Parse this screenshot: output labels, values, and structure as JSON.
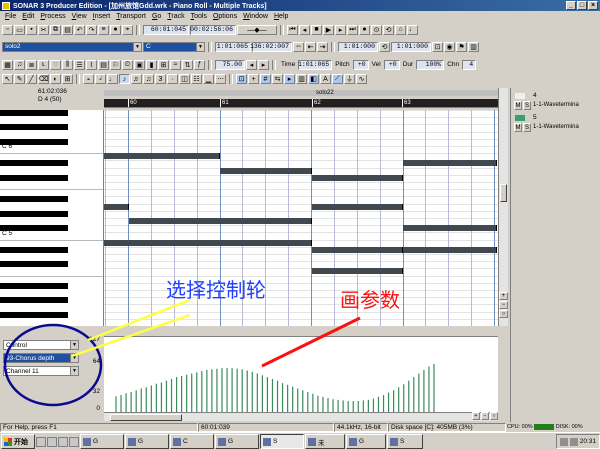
{
  "window": {
    "title": "SONAR 3 Producer Edition - [加州旅馆Gdd.wrk - Piano Roll - Multiple Tracks]",
    "buttons": [
      "_",
      "□",
      "×"
    ]
  },
  "menu": [
    "File",
    "Edit",
    "Process",
    "View",
    "Insert",
    "Transport",
    "Go",
    "Track",
    "Tools",
    "Options",
    "Window",
    "Help"
  ],
  "transport": {
    "time_mbt": "60:01:045",
    "time_smpte": "00:02:56:06"
  },
  "toolbar2": {
    "track_combo": "solo2",
    "key_combo": "C",
    "now_time": "1:01:065",
    "end_time": "136:02:007",
    "loop_start": "1:01:000",
    "loop_end": "1:01:000"
  },
  "toolbar3": {
    "tempo": "75.00",
    "time_label": "Time",
    "time_value": "1:01:065",
    "pitch_label": "Pitch",
    "pitch_value": "+0",
    "vel_label": "Vel",
    "vel_value": "+0",
    "dur_label": "Dur",
    "dur_value": "100%",
    "chn_label": "Chn",
    "chn_value": "4"
  },
  "pianoroll": {
    "position": "61:02:036",
    "note": "D 4 (50)",
    "octave_labels": [
      "C 6",
      "C 5"
    ],
    "ruler_measures": [
      "60",
      "61",
      "62",
      "63"
    ],
    "marker": "solo22",
    "notes": [
      {
        "start": 0.0,
        "end": 1.27,
        "row": 6
      },
      {
        "start": 1.27,
        "end": 2.27,
        "row": 8
      },
      {
        "start": 2.27,
        "end": 3.27,
        "row": 9
      },
      {
        "start": 3.27,
        "end": 4.3,
        "row": 7
      },
      {
        "start": 0.0,
        "end": 0.27,
        "row": 13
      },
      {
        "start": 0.27,
        "end": 2.27,
        "row": 15
      },
      {
        "start": 2.27,
        "end": 3.27,
        "row": 13
      },
      {
        "start": 3.27,
        "end": 4.3,
        "row": 16
      },
      {
        "start": 0.0,
        "end": 2.27,
        "row": 18
      },
      {
        "start": 2.27,
        "end": 3.27,
        "row": 19
      },
      {
        "start": 2.27,
        "end": 3.27,
        "row": 22
      },
      {
        "start": 3.27,
        "end": 4.3,
        "row": 19
      }
    ]
  },
  "controller": {
    "type": "Control",
    "param": "93-Chorus depth",
    "channel": "Channel 11",
    "scale": [
      "127",
      "64",
      "32",
      "0"
    ],
    "values": [
      28,
      30,
      33,
      35,
      38,
      41,
      43,
      46,
      49,
      51,
      54,
      57,
      60,
      62,
      64,
      66,
      68,
      70,
      72,
      73,
      74,
      75,
      75,
      75,
      74,
      73,
      71,
      69,
      66,
      63,
      60,
      57,
      54,
      50,
      47,
      44,
      41,
      38,
      35,
      32,
      29,
      27,
      25,
      23,
      22,
      21,
      20,
      20,
      20,
      21,
      22,
      24,
      27,
      30,
      34,
      38,
      43,
      48,
      54,
      60,
      66,
      72,
      78,
      82
    ]
  },
  "tracks": [
    {
      "num": "4",
      "output": "1-1-Wavetermina",
      "color": "#f0f0f0"
    },
    {
      "num": "5",
      "output": "1-1-Wavetermina",
      "color": "#3aa070"
    }
  ],
  "statusbar": {
    "help": "For Help, press F1",
    "time": "60:01:039",
    "audio": "44.1kHz, 16-bit",
    "disk": "Disk space [C]: 405MB (3%)",
    "cpu": "CPU: 00%",
    "disk_meter": "DISK: 00%"
  },
  "taskbar": {
    "start": "开始",
    "tasks": [
      "G",
      "G",
      "C",
      "G",
      "S",
      "未",
      "G",
      "S"
    ],
    "clock": "20:31"
  },
  "annotations": {
    "left": "选择控制轮",
    "right": "画参数"
  }
}
